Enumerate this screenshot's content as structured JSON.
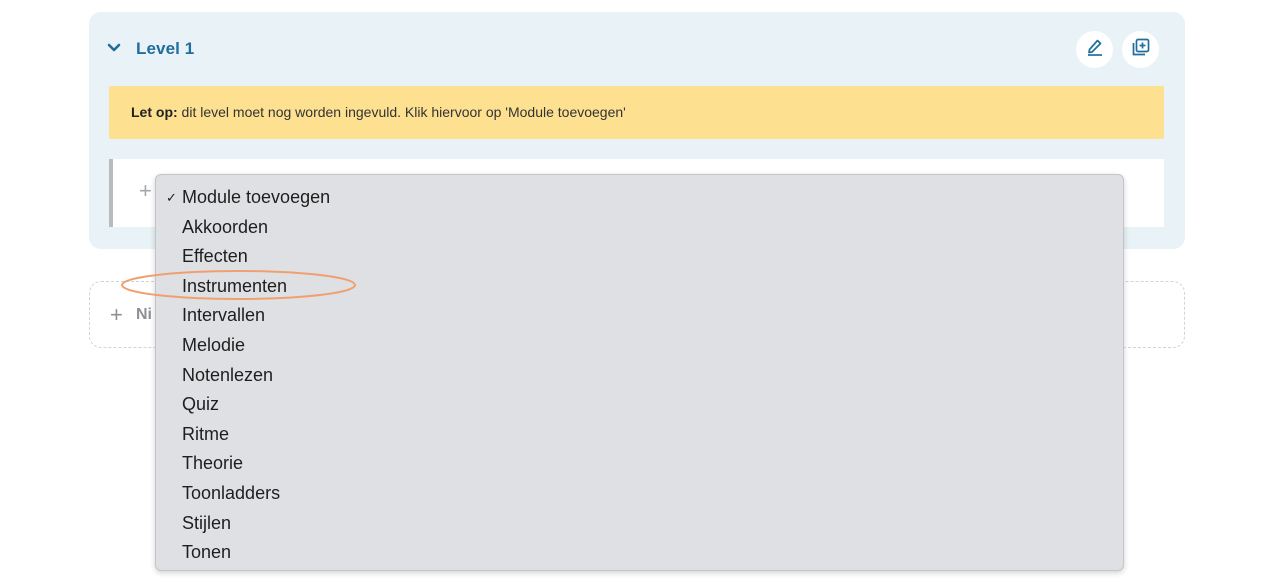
{
  "level": {
    "title": "Level 1",
    "edit_icon": "pencil-icon",
    "duplicate_icon": "duplicate-icon",
    "accent": "#1f6e9c"
  },
  "warning": {
    "bold": "Let op:",
    "text": " dit level moet nog worden ingevuld. Klik hiervoor op 'Module toevoegen'",
    "background": "#fde090"
  },
  "module_row": {
    "plus": "+"
  },
  "new_level": {
    "plus": "+",
    "label": "Ni"
  },
  "dropdown": {
    "selected": "Module toevoegen",
    "options": [
      "Module toevoegen",
      "Akkoorden",
      "Effecten",
      "Instrumenten",
      "Intervallen",
      "Melodie",
      "Notenlezen",
      "Quiz",
      "Ritme",
      "Theorie",
      "Toonladders",
      "Stijlen",
      "Tonen"
    ],
    "highlighted": "Instrumenten",
    "highlight_color": "#f0a070"
  }
}
